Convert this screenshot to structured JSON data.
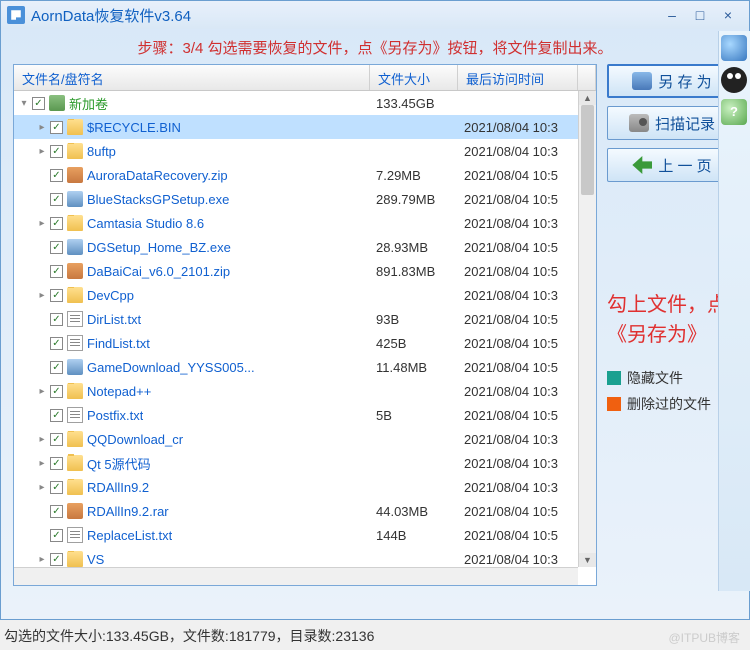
{
  "window": {
    "title": "AornData恢复软件v3.64"
  },
  "instruction": "步骤：3/4 勾选需要恢复的文件，点《另存为》按钮，将文件复制出来。",
  "columns": {
    "name": "文件名/盘符名",
    "size": "文件大小",
    "time": "最后访问时间"
  },
  "rows": [
    {
      "indent": 0,
      "exp": "▾",
      "icon": "drive",
      "name": "新加卷",
      "size": "133.45GB",
      "time": "",
      "root": true,
      "sel": false
    },
    {
      "indent": 1,
      "exp": "▸",
      "icon": "folder",
      "name": "$RECYCLE.BIN",
      "size": "",
      "time": "2021/08/04 10:3",
      "sel": true
    },
    {
      "indent": 1,
      "exp": "▸",
      "icon": "folder",
      "name": "8uftp",
      "size": "",
      "time": "2021/08/04 10:3"
    },
    {
      "indent": 1,
      "exp": "",
      "icon": "zip",
      "name": "AuroraDataRecovery.zip",
      "size": "7.29MB",
      "time": "2021/08/04 10:5"
    },
    {
      "indent": 1,
      "exp": "",
      "icon": "exe",
      "name": "BlueStacksGPSetup.exe",
      "size": "289.79MB",
      "time": "2021/08/04 10:5"
    },
    {
      "indent": 1,
      "exp": "▸",
      "icon": "folder",
      "name": "Camtasia Studio 8.6",
      "size": "",
      "time": "2021/08/04 10:3"
    },
    {
      "indent": 1,
      "exp": "",
      "icon": "exe",
      "name": "DGSetup_Home_BZ.exe",
      "size": "28.93MB",
      "time": "2021/08/04 10:5"
    },
    {
      "indent": 1,
      "exp": "",
      "icon": "zip",
      "name": "DaBaiCai_v6.0_2101.zip",
      "size": "891.83MB",
      "time": "2021/08/04 10:5"
    },
    {
      "indent": 1,
      "exp": "▸",
      "icon": "folder",
      "name": "DevCpp",
      "size": "",
      "time": "2021/08/04 10:3"
    },
    {
      "indent": 1,
      "exp": "",
      "icon": "txt",
      "name": "DirList.txt",
      "size": "93B",
      "time": "2021/08/04 10:5"
    },
    {
      "indent": 1,
      "exp": "",
      "icon": "txt",
      "name": "FindList.txt",
      "size": "425B",
      "time": "2021/08/04 10:5"
    },
    {
      "indent": 1,
      "exp": "",
      "icon": "exe",
      "name": "GameDownload_YYSS005...",
      "size": "11.48MB",
      "time": "2021/08/04 10:5"
    },
    {
      "indent": 1,
      "exp": "▸",
      "icon": "folder",
      "name": "Notepad++",
      "size": "",
      "time": "2021/08/04 10:3"
    },
    {
      "indent": 1,
      "exp": "",
      "icon": "txt",
      "name": "Postfix.txt",
      "size": "5B",
      "time": "2021/08/04 10:5"
    },
    {
      "indent": 1,
      "exp": "▸",
      "icon": "folder",
      "name": "QQDownload_cr",
      "size": "",
      "time": "2021/08/04 10:3"
    },
    {
      "indent": 1,
      "exp": "▸",
      "icon": "folder",
      "name": "Qt 5源代码",
      "size": "",
      "time": "2021/08/04 10:3"
    },
    {
      "indent": 1,
      "exp": "▸",
      "icon": "folder",
      "name": "RDAllIn9.2",
      "size": "",
      "time": "2021/08/04 10:3"
    },
    {
      "indent": 1,
      "exp": "",
      "icon": "zip",
      "name": "RDAllIn9.2.rar",
      "size": "44.03MB",
      "time": "2021/08/04 10:5"
    },
    {
      "indent": 1,
      "exp": "",
      "icon": "txt",
      "name": "ReplaceList.txt",
      "size": "144B",
      "time": "2021/08/04 10:5"
    },
    {
      "indent": 1,
      "exp": "▸",
      "icon": "folder",
      "name": "VS",
      "size": "",
      "time": "2021/08/04 10:3"
    }
  ],
  "side_buttons": {
    "save_as": "另 存 为",
    "scan_log": "扫描记录",
    "back": "上 一 页"
  },
  "side_note": "勾上文件，点《另存为》",
  "legend": {
    "hidden": {
      "color": "#1aa090",
      "label": "隐藏文件"
    },
    "deleted": {
      "color": "#f06010",
      "label": "删除过的文件"
    }
  },
  "status": "勾选的文件大小:133.45GB，文件数:181779，目录数:23136",
  "watermark": "@ITPUB博客"
}
